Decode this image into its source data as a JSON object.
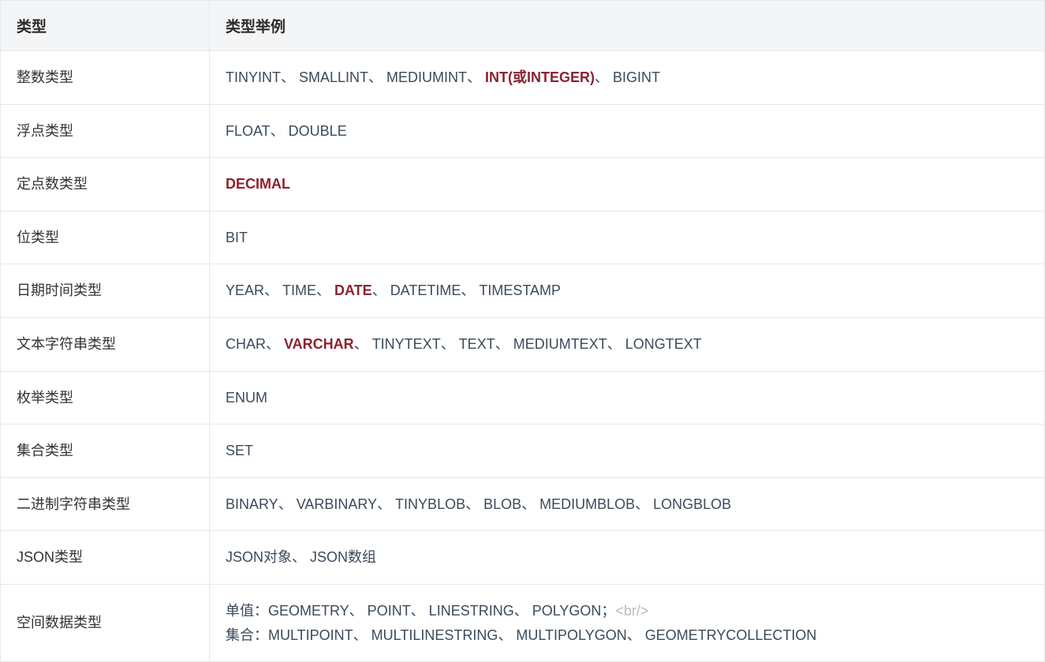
{
  "headers": {
    "col1": "类型",
    "col2": "类型举例"
  },
  "rows": [
    {
      "type": "整数类型",
      "segments": [
        {
          "text": "TINYINT、 SMALLINT、 MEDIUMINT、 ",
          "style": "normal"
        },
        {
          "text": "INT(或INTEGER)",
          "style": "highlight"
        },
        {
          "text": "、 BIGINT",
          "style": "normal"
        }
      ]
    },
    {
      "type": "浮点类型",
      "segments": [
        {
          "text": "FLOAT、 DOUBLE",
          "style": "normal"
        }
      ]
    },
    {
      "type": "定点数类型",
      "segments": [
        {
          "text": "DECIMAL",
          "style": "highlight"
        }
      ]
    },
    {
      "type": "位类型",
      "segments": [
        {
          "text": "BIT",
          "style": "normal"
        }
      ]
    },
    {
      "type": "日期时间类型",
      "segments": [
        {
          "text": "YEAR、 TIME、 ",
          "style": "normal"
        },
        {
          "text": "DATE",
          "style": "highlight"
        },
        {
          "text": "、 DATETIME、 TIMESTAMP",
          "style": "normal"
        }
      ]
    },
    {
      "type": "文本字符串类型",
      "segments": [
        {
          "text": "CHAR、 ",
          "style": "normal"
        },
        {
          "text": "VARCHAR",
          "style": "highlight"
        },
        {
          "text": "、 TINYTEXT、 TEXT、 MEDIUMTEXT、 LONGTEXT",
          "style": "normal"
        }
      ]
    },
    {
      "type": "枚举类型",
      "segments": [
        {
          "text": "ENUM",
          "style": "normal"
        }
      ]
    },
    {
      "type": "集合类型",
      "segments": [
        {
          "text": "SET",
          "style": "normal"
        }
      ]
    },
    {
      "type": "二进制字符串类型",
      "segments": [
        {
          "text": "BINARY、 VARBINARY、 TINYBLOB、 BLOB、 MEDIUMBLOB、 LONGBLOB",
          "style": "normal"
        }
      ]
    },
    {
      "type": "JSON类型",
      "segments": [
        {
          "text": "JSON对象、 JSON数组",
          "style": "normal"
        }
      ]
    },
    {
      "type": "空间数据类型",
      "segments": [
        {
          "text": "单值：GEOMETRY、 POINT、 LINESTRING、 POLYGON；",
          "style": "normal"
        },
        {
          "text": "<br/>",
          "style": "gray-code"
        },
        {
          "text": "\n集合：MULTIPOINT、 MULTILINESTRING、 MULTIPOLYGON、 GEOMETRYCOLLECTION",
          "style": "normal"
        }
      ]
    }
  ]
}
